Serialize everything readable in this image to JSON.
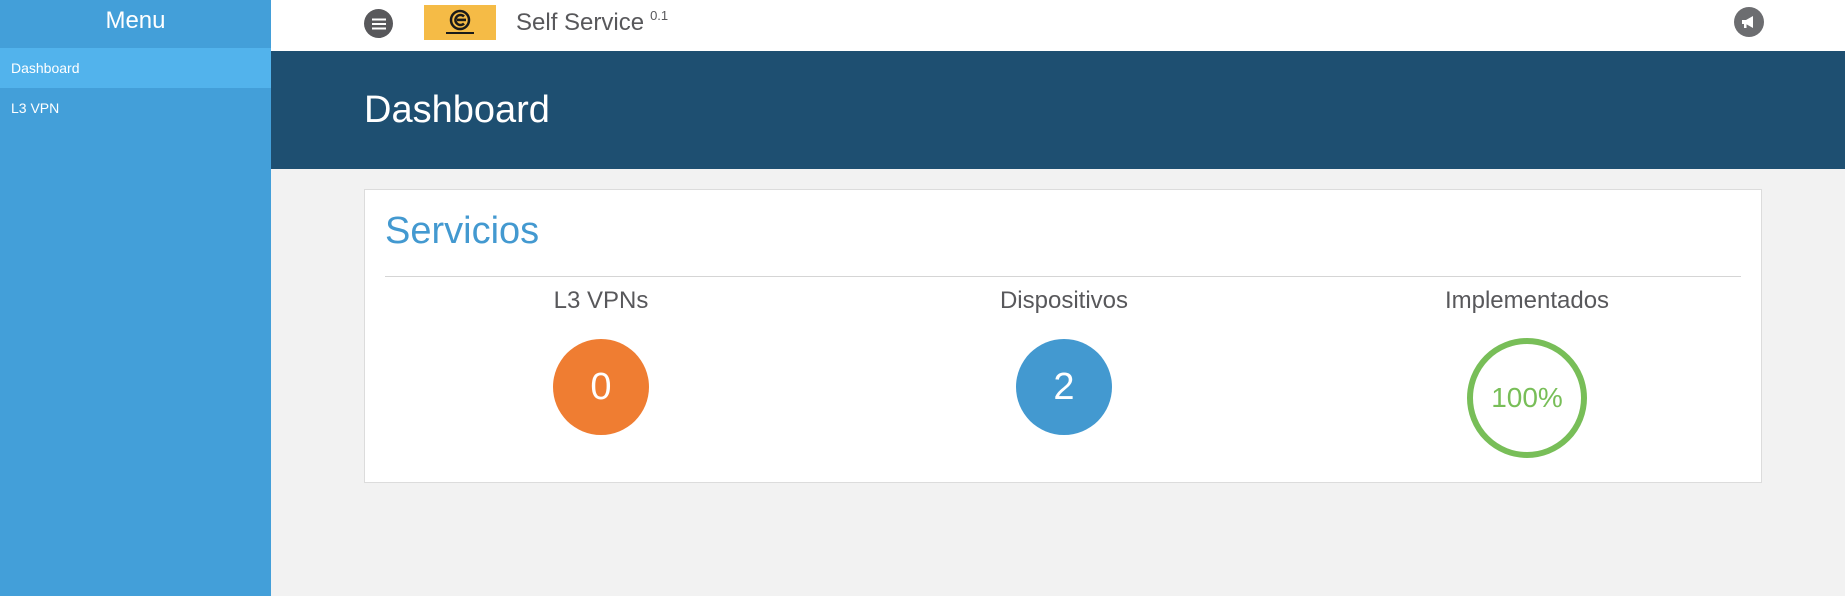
{
  "sidebar": {
    "title": "Menu",
    "items": [
      {
        "label": "Dashboard",
        "active": true
      },
      {
        "label": "L3 VPN",
        "active": false
      }
    ]
  },
  "topbar": {
    "menu_icon": "hamburger-menu-icon",
    "logo_text": "CAPIVAZ",
    "app_name": "Self Service",
    "version": "0.1",
    "announcement_icon": "megaphone-icon"
  },
  "header": {
    "title": "Dashboard"
  },
  "services_card": {
    "title": "Servicios",
    "stats": [
      {
        "label": "L3 VPNs",
        "value": "0",
        "color": "#ef7d32"
      },
      {
        "label": "Dispositivos",
        "value": "2",
        "color": "#4399d0"
      },
      {
        "label": "Implementados",
        "value": "100%",
        "percent": 100,
        "color": "#78be58"
      }
    ]
  },
  "colors": {
    "sidebar": "#439fd9",
    "sidebar_active": "#52b3ec",
    "header": "#1e4f71",
    "accent": "#4399d0",
    "logo_bg": "#f5bb46"
  }
}
